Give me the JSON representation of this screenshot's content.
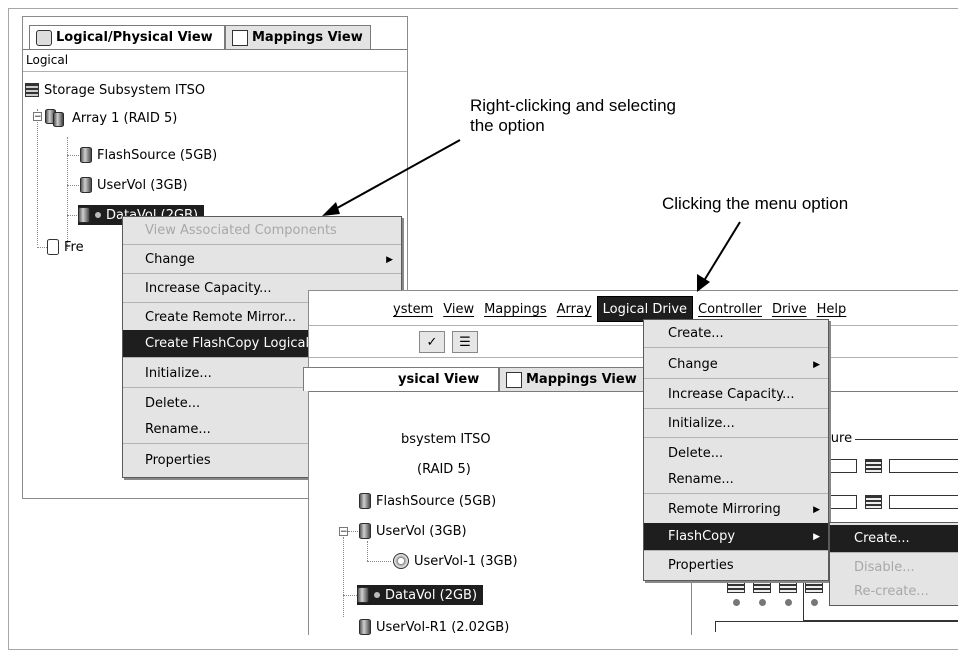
{
  "left_window": {
    "tabs": {
      "logical_physical": "Logical/Physical View",
      "mappings": "Mappings View"
    },
    "section_label": "Logical",
    "tree": {
      "subsystem": "Storage Subsystem ITSO",
      "array": "Array 1 (RAID 5)",
      "flashsource": "FlashSource (5GB)",
      "uservol": "UserVol (3GB)",
      "datavol": "DataVol (2GB)",
      "free": "Fre"
    },
    "context_menu": {
      "view_associated": "View Associated Components",
      "change": "Change",
      "increase_capacity": "Increase Capacity...",
      "create_remote_mirror": "Create Remote Mirror...",
      "create_flashcopy": "Create FlashCopy Logical Drive...",
      "initialize": "Initialize...",
      "delete": "Delete...",
      "rename": "Rename...",
      "properties": "Properties"
    }
  },
  "right_window": {
    "menubar": {
      "system": "ystem",
      "view": "View",
      "mappings": "Mappings",
      "array": "Array",
      "logical_drive": "Logical Drive",
      "controller": "Controller",
      "drive": "Drive",
      "help": "Help"
    },
    "tabs": {
      "logical_physical": "ysical View",
      "mappings": "Mappings View"
    },
    "tree": {
      "subsystem": "bsystem ITSO",
      "array": "(RAID 5)",
      "flashsource": "FlashSource (5GB)",
      "uservol": "UserVol (3GB)",
      "uservol1": "UserVol-1 (3GB)",
      "datavol": "DataVol (2GB)",
      "uservol_r1": "UserVol-R1 (2.02GB)"
    },
    "enclosure_label": "sure",
    "logical_drive_menu": {
      "create": "Create...",
      "change": "Change",
      "increase_capacity": "Increase Capacity...",
      "initialize": "Initialize...",
      "delete": "Delete...",
      "rename": "Rename...",
      "remote_mirroring": "Remote Mirroring",
      "flashcopy": "FlashCopy",
      "properties": "Properties"
    },
    "flashcopy_submenu": {
      "create": "Create...",
      "disable": "Disable...",
      "recreate": "Re-create..."
    }
  },
  "annotations": {
    "right_click": "Right-clicking and selecting\nthe option",
    "menu_option": "Clicking the menu option"
  }
}
